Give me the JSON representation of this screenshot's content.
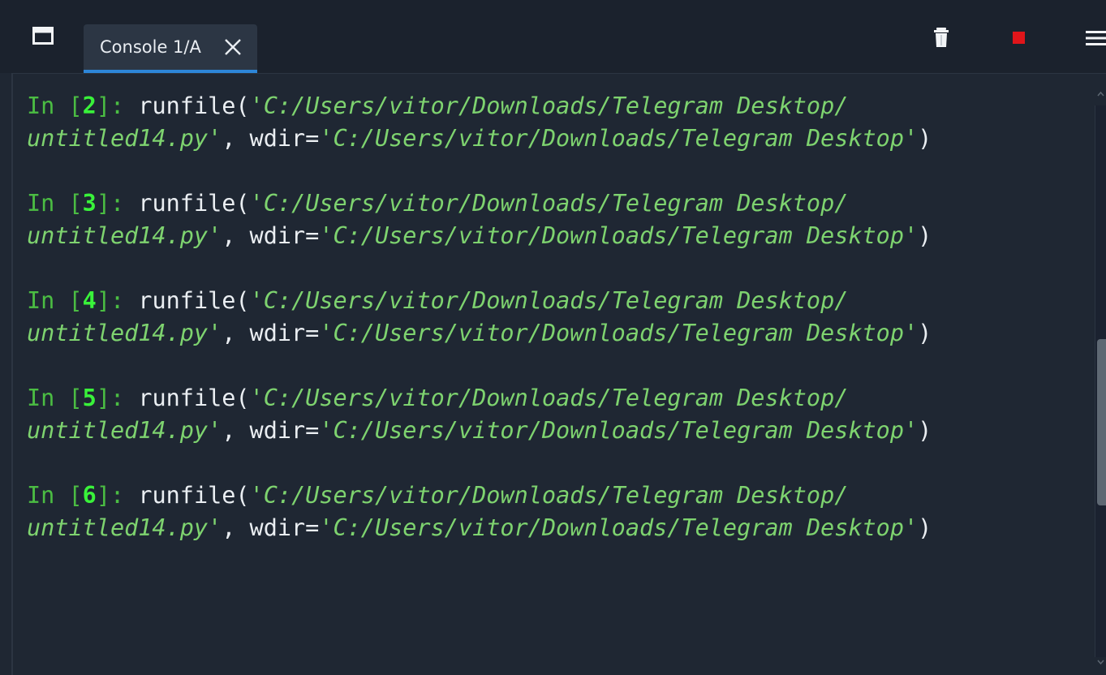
{
  "tab": {
    "label": "Console 1/A",
    "close_icon": "close-icon"
  },
  "toolbar": {
    "window_icon": "window-icon",
    "trash_icon": "trash-icon",
    "stop_icon": "stop-icon",
    "menu_icon": "hamburger-menu-icon"
  },
  "colors": {
    "background": "#1f2733",
    "tab_underline": "#2d86d9",
    "prompt_green": "#4bbd43",
    "prompt_number": "#39f23a",
    "string_green": "#7ed36f",
    "stop_red": "#e0151a"
  },
  "console": {
    "entries": [
      {
        "prompt_in": "In ",
        "prompt_open": "[",
        "prompt_num": "2",
        "prompt_close": "]: ",
        "func": "runfile(",
        "path_line1": "'C:/Users/vitor/Downloads/Telegram Desktop/",
        "path_line2": "untitled14.py'",
        "sep": ", wdir=",
        "wdir": "'C:/Users/vitor/Downloads/Telegram Desktop'",
        "end": ")"
      },
      {
        "prompt_in": "In ",
        "prompt_open": "[",
        "prompt_num": "3",
        "prompt_close": "]: ",
        "func": "runfile(",
        "path_line1": "'C:/Users/vitor/Downloads/Telegram Desktop/",
        "path_line2": "untitled14.py'",
        "sep": ", wdir=",
        "wdir": "'C:/Users/vitor/Downloads/Telegram Desktop'",
        "end": ")"
      },
      {
        "prompt_in": "In ",
        "prompt_open": "[",
        "prompt_num": "4",
        "prompt_close": "]: ",
        "func": "runfile(",
        "path_line1": "'C:/Users/vitor/Downloads/Telegram Desktop/",
        "path_line2": "untitled14.py'",
        "sep": ", wdir=",
        "wdir": "'C:/Users/vitor/Downloads/Telegram Desktop'",
        "end": ")"
      },
      {
        "prompt_in": "In ",
        "prompt_open": "[",
        "prompt_num": "5",
        "prompt_close": "]: ",
        "func": "runfile(",
        "path_line1": "'C:/Users/vitor/Downloads/Telegram Desktop/",
        "path_line2": "untitled14.py'",
        "sep": ", wdir=",
        "wdir": "'C:/Users/vitor/Downloads/Telegram Desktop'",
        "end": ")"
      },
      {
        "prompt_in": "In ",
        "prompt_open": "[",
        "prompt_num": "6",
        "prompt_close": "]: ",
        "func": "runfile(",
        "path_line1": "'C:/Users/vitor/Downloads/Telegram Desktop/",
        "path_line2": "untitled14.py'",
        "sep": ", wdir=",
        "wdir": "'C:/Users/vitor/Downloads/Telegram Desktop'",
        "end": ")"
      }
    ]
  }
}
